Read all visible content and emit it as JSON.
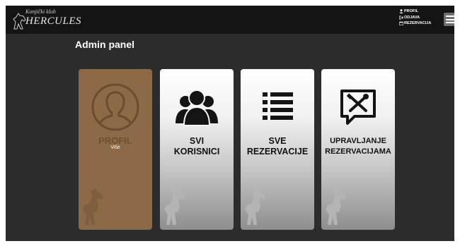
{
  "brand": {
    "top_text": "Konjički klub",
    "main_text": "HERCULES"
  },
  "nav": {
    "links": [
      {
        "label": "PROFIL",
        "icon": "user-icon"
      },
      {
        "label": "ODJAVA",
        "icon": "sign-out-icon"
      },
      {
        "label": "REZERVACIJA",
        "icon": "calendar-icon"
      }
    ]
  },
  "page": {
    "title": "Admin panel"
  },
  "cards": {
    "profil": {
      "label": "PROFIL",
      "hover_text": "Više",
      "icon": "user-circle-icon"
    },
    "svi_korisnici": {
      "line1": "SVI",
      "line2": "KORISNICI",
      "icon": "users-icon"
    },
    "sve_rezervacije": {
      "line1": "SVE",
      "line2": "REZERVACIJE",
      "icon": "list-icon"
    },
    "upravljanje": {
      "line1": "UPRAVLJANJE",
      "line2": "REZERVACIJAMA",
      "icon": "tools-icon"
    }
  },
  "colors": {
    "background": "#2c2c2c",
    "navbar": "#141414",
    "card_active": "#8c6a48",
    "card_gradient_top": "#ffffff",
    "card_gradient_bottom": "#8e8e8e"
  }
}
